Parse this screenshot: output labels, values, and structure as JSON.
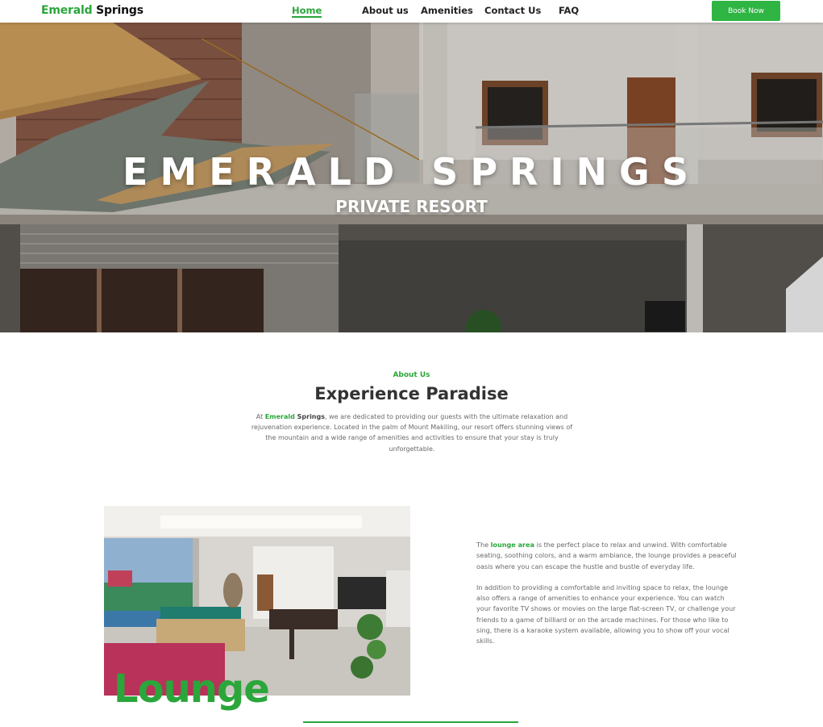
{
  "nav": {
    "logo_green": "Emerald",
    "logo_dark": "Springs",
    "items": [
      "Home",
      "About us",
      "Amenities",
      "Contact Us",
      "FAQ"
    ],
    "active": "Home",
    "book_label": "Book Now"
  },
  "hero": {
    "title": "EMERALD SPRINGS",
    "subtitle": "PRIVATE RESORT"
  },
  "about": {
    "label": "About Us",
    "heading": "Experience Paradise",
    "text_prefix": "At ",
    "brand_green": "Emerald",
    "brand_dark": " Springs",
    "text_body": ", we are dedicated to providing our guests with the ultimate relaxation and rejuvenation experience. Located in the palm of Mount Makiling, our resort offers stunning views of the mountain and a wide range of amenities and activities to ensure that your stay is truly unforgettable."
  },
  "lounge": {
    "title": "Lounge",
    "p1_prefix": "The ",
    "p1_highlight": "lounge area",
    "p1_body": " is the perfect place to relax and unwind. With comfortable seating, soothing colors, and a warm ambiance, the lounge provides a peaceful oasis where you can escape the hustle and bustle of everyday life.",
    "p2": "In addition to providing a comfortable and inviting space to relax, the lounge also offers a range of amenities to enhance your experience. You can watch your favorite TV shows or movies on the large flat-screen TV, or challenge your friends to a game of billiard or  on the arcade machines. For those who like to sing, there is a karaoke system available, allowing you to show off your vocal skills."
  },
  "colors": {
    "accent": "#2aa63a",
    "button": "#2fb543"
  }
}
